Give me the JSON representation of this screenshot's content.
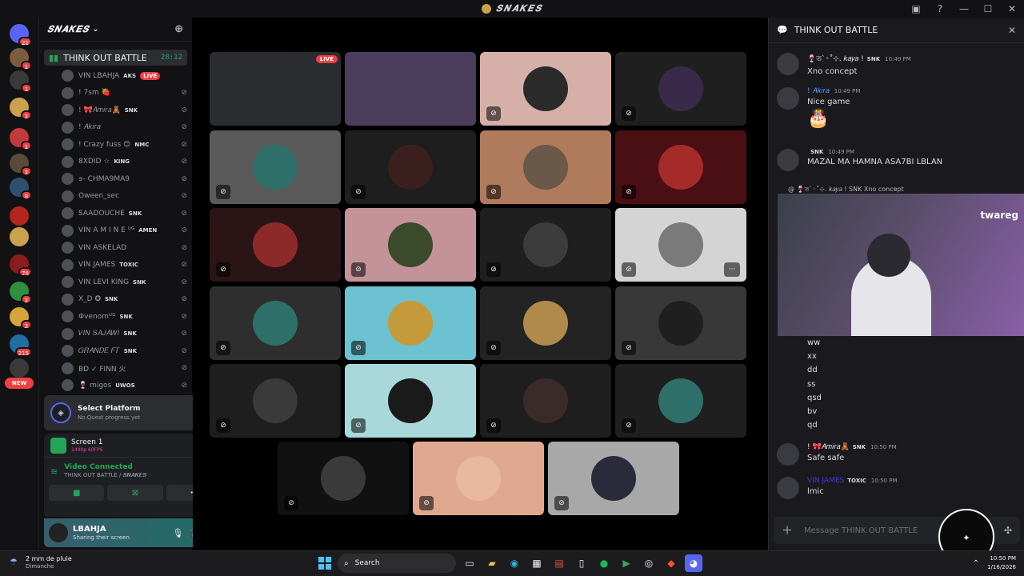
{
  "app": {
    "title": "𝑺𝑵𝑨𝑲𝑬𝑺",
    "window_controls": [
      "▣",
      "?",
      "—",
      "☐",
      "✕"
    ]
  },
  "servers": {
    "items": [
      {
        "badge": "22",
        "color": "#5865f2"
      },
      {
        "badge": "1",
        "color": "#7a5c3e"
      },
      {
        "badge": "1",
        "color": "#3a3a3a"
      },
      {
        "badge": "2",
        "color": "#c9a24b"
      },
      {
        "badge": "1",
        "color": "#c43a3a"
      },
      {
        "badge": "2",
        "color": "#5a4a3a"
      },
      {
        "badge": "8",
        "color": "#2f4f6f"
      },
      {
        "badge": "",
        "color": "#b3261e"
      },
      {
        "badge": "",
        "color": "#c9a24b"
      },
      {
        "badge": "74",
        "color": "#8c1c1c"
      },
      {
        "badge": "2",
        "color": "#2f8f3f"
      },
      {
        "badge": "2",
        "color": "#d4a63a"
      },
      {
        "badge": "215",
        "color": "#1f6fa3"
      },
      {
        "badge": "",
        "color": "#3a3a3a"
      }
    ],
    "new_label": "NEW"
  },
  "sidebar": {
    "server_name": "𝑺𝑵𝑨𝑲𝑬𝑺",
    "voice_channel": {
      "name": "THINK OUT BATTLE",
      "time": "28:12"
    },
    "members": [
      {
        "name": "VIN LBAHJA",
        "tag": "AKS",
        "live": true
      },
      {
        "name": "! 7sm 🍓",
        "tag": ""
      },
      {
        "name": "! 🎀𝐴𝑚𝑖𝑟𝑎🧸",
        "tag": "SNK"
      },
      {
        "name": "! 𝐴𝑘𝑖𝑟𝑎",
        "tag": ""
      },
      {
        "name": "! Crazy fuss 😊",
        "tag": "NMC"
      },
      {
        "name": "8XDID ☆",
        "tag": "KING"
      },
      {
        "name": "϶- CHMA9MA9",
        "tag": ""
      },
      {
        "name": "Oween_sec",
        "tag": ""
      },
      {
        "name": "SAADOUCHE",
        "tag": "SNK"
      },
      {
        "name": "VIN A M I N E ᵁᴳ",
        "tag": "AMEN"
      },
      {
        "name": "VIN ASKELAD",
        "tag": ""
      },
      {
        "name": "VIN JAMES",
        "tag": "TOXIC"
      },
      {
        "name": "VIN LEVI KING",
        "tag": "SNK"
      },
      {
        "name": "X_D ✪",
        "tag": "SNK"
      },
      {
        "name": "Φvenomᵁᴳ",
        "tag": "SNK"
      },
      {
        "name": "𝑉𝐼𝑁 𝑆𝐴𝐽𝐴𝑊𝐼",
        "tag": "SNK"
      },
      {
        "name": "𝐺𝑅𝐴𝑁𝐷𝐸 𝐹𝑇",
        "tag": "SNK"
      },
      {
        "name": "BD ✓ FINN 火",
        "tag": ""
      },
      {
        "name": "🍷 migos",
        "tag": "UWOS"
      }
    ],
    "live_label": "LIVE"
  },
  "quest": {
    "title": "Select Platform",
    "subtitle": "No Quest progress yet"
  },
  "screen": {
    "title": "Screen 1",
    "quality": "1440p 60FPS"
  },
  "voice": {
    "status": "Video Connected",
    "location": "THINK OUT BATTLE / 𝑺𝑵𝑨𝑲𝑬𝑺"
  },
  "user": {
    "name": "LBAHJA",
    "status": "Sharing their screen"
  },
  "stage": {
    "tiles": [
      {
        "bg": "#2a2c30",
        "av": "#2a2c30",
        "live": true
      },
      {
        "bg": "#4a3d5e",
        "av": "#4a3d5e"
      },
      {
        "bg": "#d6b0a8",
        "av": "#2b2b2b"
      },
      {
        "bg": "#1f1f1f",
        "av": "#3a2a4a"
      },
      {
        "bg": "#5a5a5a",
        "av": "#2f6f6a"
      },
      {
        "bg": "#1e1e1e",
        "av": "#3b1f1f"
      },
      {
        "bg": "#b07a5c",
        "av": "#6a5848"
      },
      {
        "bg": "#4a0f12",
        "av": "#a52a2a"
      },
      {
        "bg": "#2a1416",
        "av": "#8c2a2a"
      },
      {
        "bg": "#c4939a",
        "av": "#3a4a2a"
      },
      {
        "bg": "#1f1f1f",
        "av": "#3c3c3c"
      },
      {
        "bg": "#d4d4d4",
        "av": "#7a7a7a"
      },
      {
        "bg": "#2e2e2e",
        "av": "#2f6f6a"
      },
      {
        "bg": "#6cc2d0",
        "av": "#c49a3a"
      },
      {
        "bg": "#232323",
        "av": "#b08a4a"
      },
      {
        "bg": "#383838",
        "av": "#1f1f1f"
      },
      {
        "bg": "#1e1e1e",
        "av": "#3a3a3a"
      },
      {
        "bg": "#a8d8da",
        "av": "#1a1a1a"
      },
      {
        "bg": "#1e1e1e",
        "av": "#3a2a2a"
      },
      {
        "bg": "#1f1f1f",
        "av": "#2f6f6a"
      },
      {
        "bg": "#111111",
        "av": "#3a3a3a"
      },
      {
        "bg": "#e0a890",
        "av": "#e8b8a0"
      },
      {
        "bg": "#a8a8a8",
        "av": "#2a2a3a"
      }
    ]
  },
  "chat": {
    "title": "THINK OUT BATTLE",
    "messages": [
      {
        "author": "🍷ত`◦˚⊹. 𝑘𝑎𝑦𝑎 !",
        "tag": "SNK",
        "time": "10:49 PM",
        "text": "Xno concept",
        "color": "#f2f3f5"
      },
      {
        "author": "! 𝐴𝑘𝑖𝑟𝑎",
        "tag": "",
        "time": "10:49 PM",
        "text": "Nice game",
        "color": "#5b9bff"
      },
      {
        "author": "",
        "tag": "SNK",
        "time": "10:49 PM",
        "text": "MAZAL MA HAMNA ASA7BI LBLAN",
        "color": "#f2f3f5"
      },
      {
        "author": "! 🎀𝐴𝑚𝑖𝑟𝑎🧸",
        "tag": "SNK",
        "time": "10:50 PM",
        "text": "Safe safe",
        "color": "#f2f3f5"
      },
      {
        "author": "VIN JAMES",
        "tag": "TOXIC",
        "time": "10:50 PM",
        "text": "lmic",
        "color": "#3b3bd6"
      }
    ],
    "cake": "🎂",
    "reply_preview": "@ 🍷ত`◦˚⊹. 𝑘𝑎𝑦𝑎 ! SNK Xno concept",
    "plain_lines": [
      "ww",
      "xx",
      "dd",
      "ss",
      "qsd",
      "bv",
      "qd"
    ],
    "video_brand": "twareg",
    "input_placeholder": "Message THINK OUT BATTLE"
  },
  "taskbar": {
    "weather": "2 mm de pluie",
    "weather_sub": "Dimanche",
    "search": "Search",
    "time": "10:50 PM",
    "date": "1/16/2026"
  }
}
